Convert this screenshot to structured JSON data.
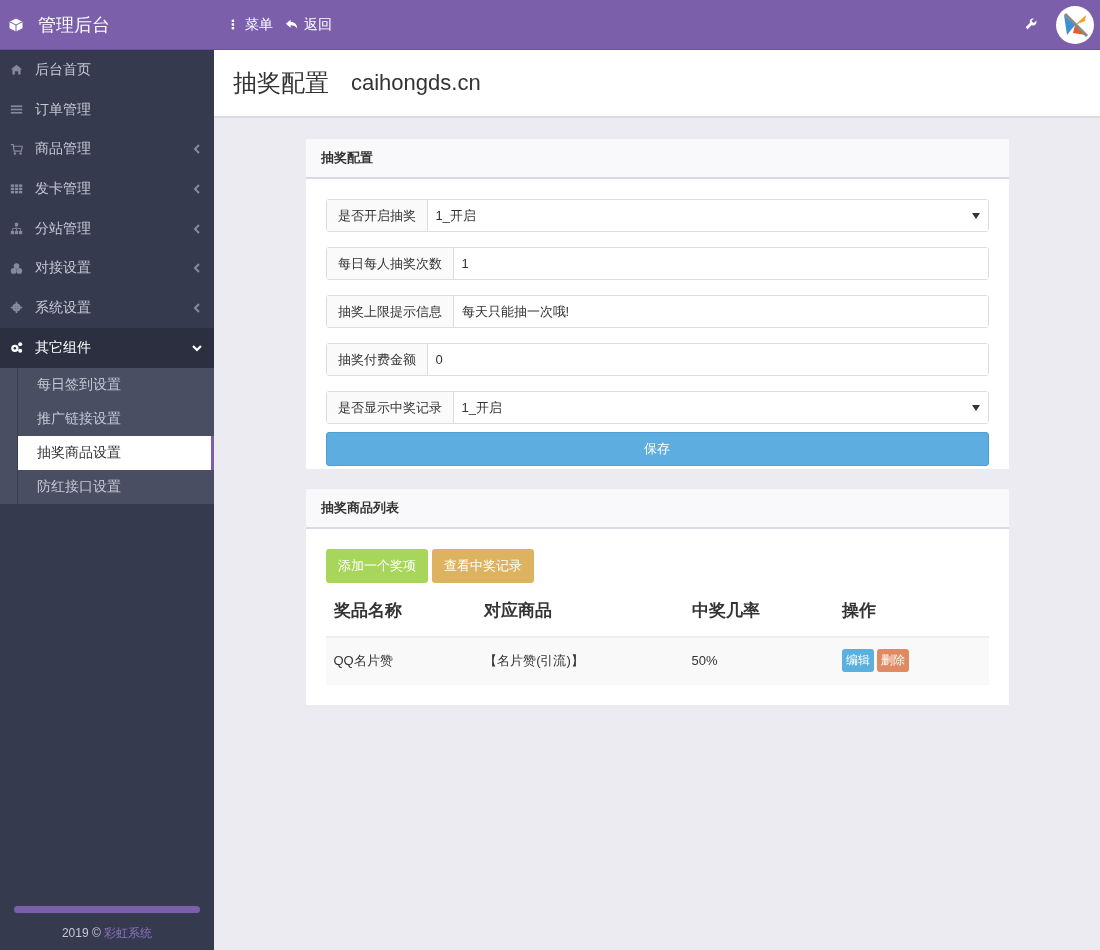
{
  "header": {
    "brand": "管理后台",
    "menu": "菜单",
    "back": "返回"
  },
  "sidebar": {
    "items": [
      {
        "label": "后台首页",
        "kind": "link",
        "expanded": false
      },
      {
        "label": "订单管理",
        "kind": "link",
        "expanded": false
      },
      {
        "label": "商品管理",
        "kind": "group",
        "expanded": false
      },
      {
        "label": "发卡管理",
        "kind": "group",
        "expanded": false
      },
      {
        "label": "分站管理",
        "kind": "group",
        "expanded": false
      },
      {
        "label": "对接设置",
        "kind": "group",
        "expanded": false
      },
      {
        "label": "系统设置",
        "kind": "group",
        "expanded": false
      },
      {
        "label": "其它组件",
        "kind": "group",
        "expanded": true,
        "children": [
          {
            "label": "每日签到设置",
            "selected": false
          },
          {
            "label": "推广链接设置",
            "selected": false
          },
          {
            "label": "抽奖商品设置",
            "selected": true
          },
          {
            "label": "防红接口设置",
            "selected": false
          }
        ]
      }
    ],
    "footer_year": "2019 ©",
    "footer_link": "彩虹系统"
  },
  "page": {
    "title": "抽奖配置",
    "subtitle": "caihongds.cn"
  },
  "config_panel": {
    "title": "抽奖配置",
    "fields": [
      {
        "label": "是否开启抽奖",
        "kind": "select",
        "value": "1_开启"
      },
      {
        "label": "每日每人抽奖次数",
        "kind": "input",
        "value": "1"
      },
      {
        "label": "抽奖上限提示信息",
        "kind": "input",
        "value": "每天只能抽一次哦!"
      },
      {
        "label": "抽奖付费金额",
        "kind": "input",
        "value": "0"
      },
      {
        "label": "是否显示中奖记录",
        "kind": "select",
        "value": "1_开启"
      }
    ],
    "save_button": "保存"
  },
  "prize_panel": {
    "title": "抽奖商品列表",
    "buttons": [
      {
        "label": "添加一个奖项",
        "color": "#a8d65a"
      },
      {
        "label": "查看中奖记录",
        "color": "#ddb35f"
      }
    ],
    "table": {
      "columns": [
        "奖品名称",
        "对应商品",
        "中奖几率",
        "操作"
      ],
      "rows": [
        {
          "name": "QQ名片赞",
          "product": "【名片赞(引流)】",
          "rate": "50%",
          "actions": [
            {
              "label": "编辑",
              "color": "#5cb0de"
            },
            {
              "label": "删除",
              "color": "#e08a63"
            }
          ]
        }
      ]
    }
  }
}
